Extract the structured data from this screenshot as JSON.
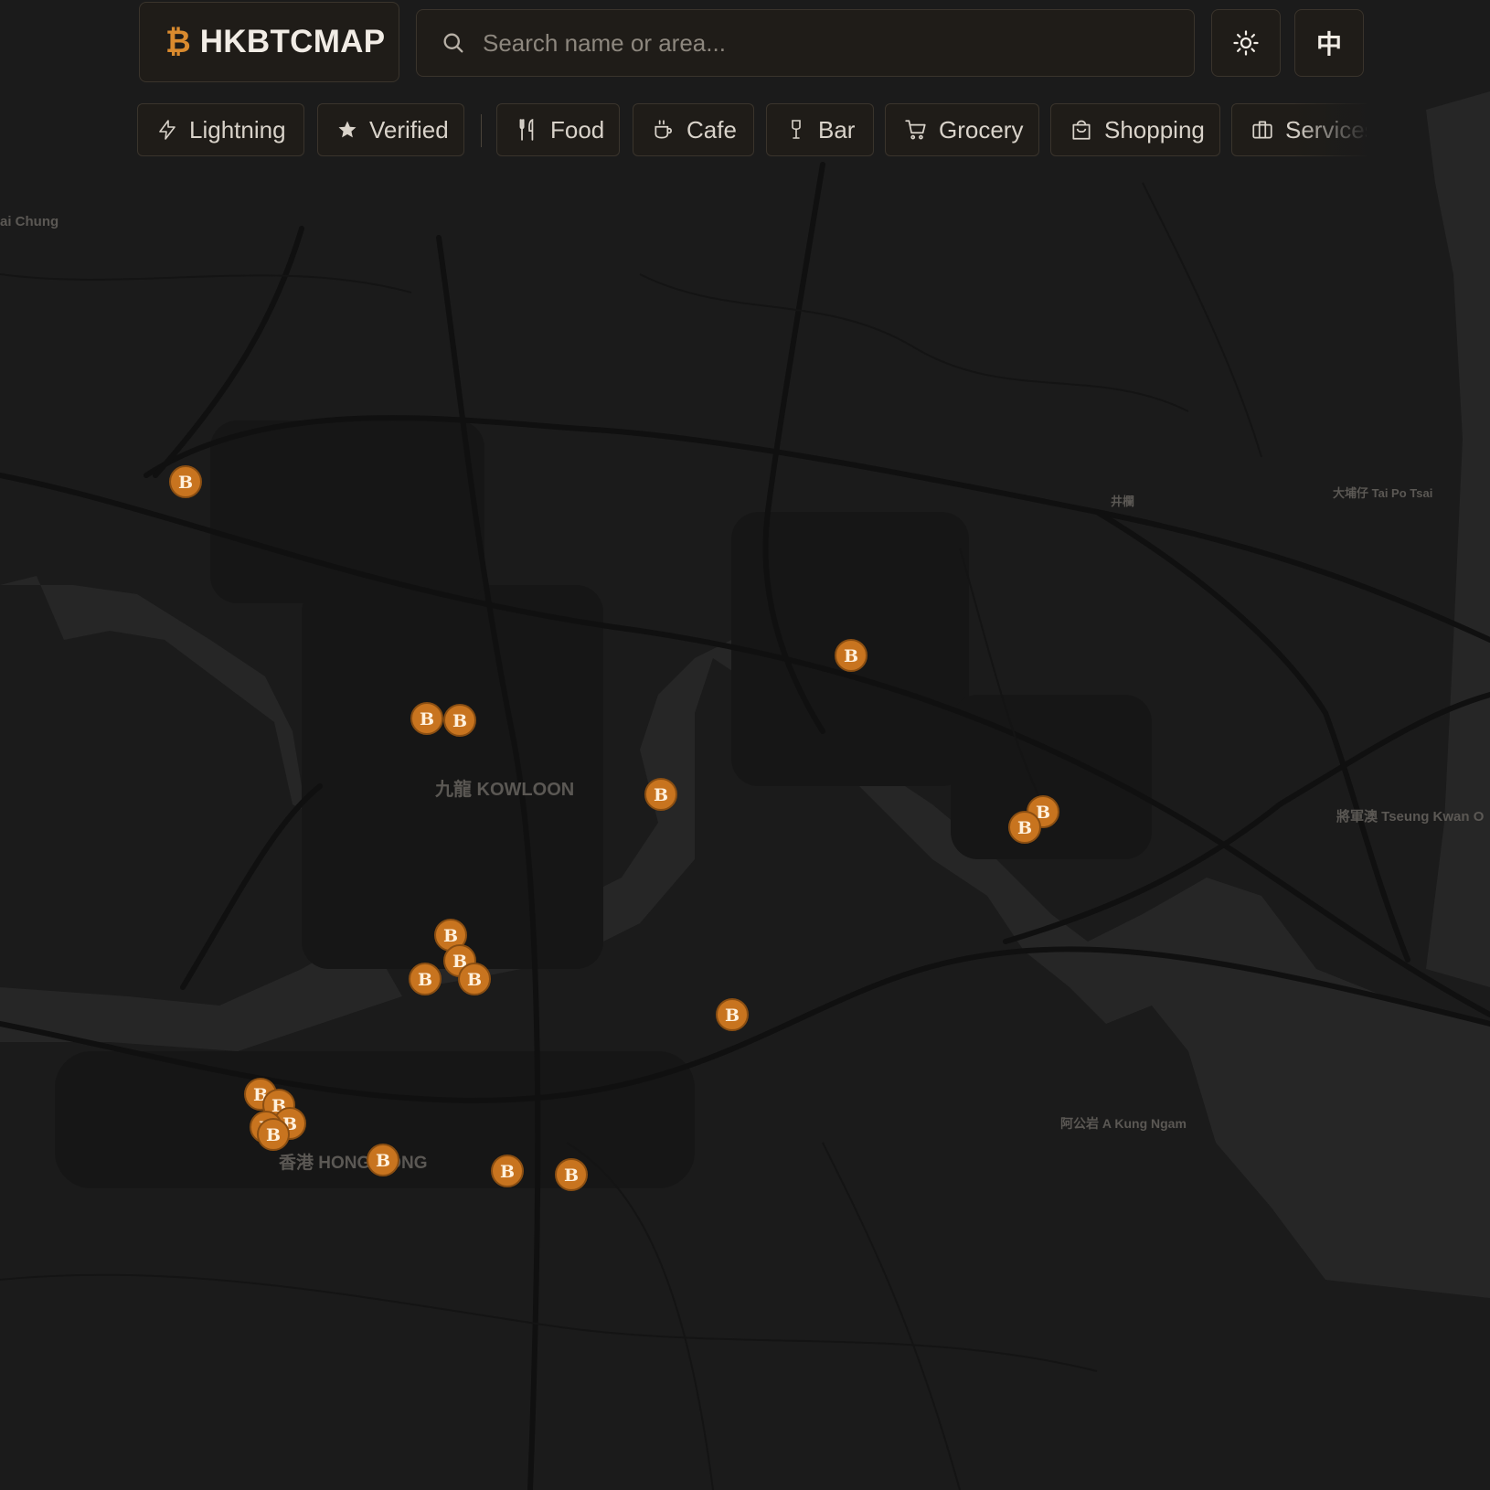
{
  "app": {
    "logo_symbol": "₿",
    "title": "HKBTCMAP"
  },
  "search": {
    "placeholder": "Search name or area..."
  },
  "controls": {
    "theme_icon": "sun-icon",
    "lang_label": "中"
  },
  "filters": [
    {
      "label": "Lightning",
      "icon": "lightning-icon"
    },
    {
      "label": "Verified",
      "icon": "star-icon"
    },
    {
      "label": "Food",
      "icon": "utensils-icon"
    },
    {
      "label": "Cafe",
      "icon": "coffee-cup-icon"
    },
    {
      "label": "Bar",
      "icon": "wine-glass-icon"
    },
    {
      "label": "Grocery",
      "icon": "cart-icon"
    },
    {
      "label": "Shopping",
      "icon": "shopping-bag-icon"
    },
    {
      "label": "Services",
      "icon": "briefcase-icon"
    }
  ],
  "map": {
    "marker_symbol": "B",
    "marker_color": "#c8741f",
    "background_color": "#1b1b1b",
    "water_color": "#262626",
    "road_color": "#121212",
    "labels": {
      "kowloon": "九龍 KOWLOON",
      "hong_kong": "香港 HONG KONG",
      "tseung_kwan_o": "將軍澳 Tseung Kwan O",
      "tai_po_tsai": "大埔仔 Tai Po Tsai",
      "a_kung_ngam": "阿公岩 A Kung Ngam",
      "kwai_chung": "ai Chung",
      "ngau_chi_wan": "井欄"
    }
  }
}
